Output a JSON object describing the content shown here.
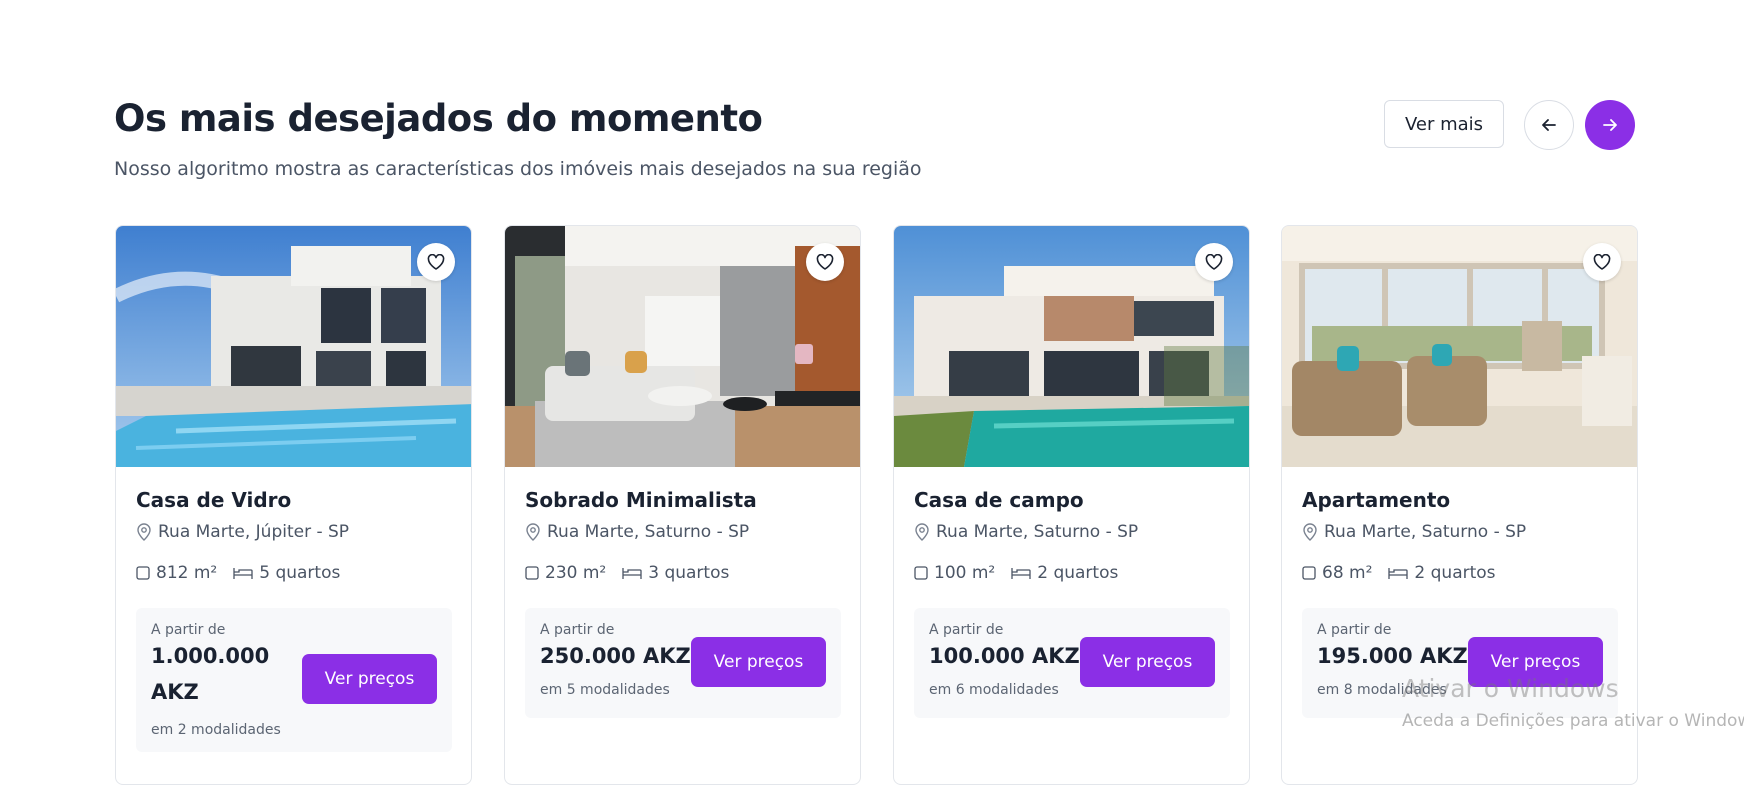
{
  "section": {
    "title": "Os mais desejados do momento",
    "subtitle": "Nosso algoritmo mostra as características dos imóveis mais desejados na sua região",
    "more_label": "Ver mais",
    "prev_icon": "arrow-left-icon",
    "next_icon": "arrow-right-icon"
  },
  "colors": {
    "accent": "#8b2fe6",
    "text_dark": "#1a2231",
    "text_muted": "#4b5565",
    "price_box_bg": "#f7f8fa"
  },
  "cards": [
    {
      "name": "Casa de Vidro",
      "address": "Rua Marte, Júpiter - SP",
      "area": "812 m²",
      "rooms": "5 quartos",
      "from_label": "A partir de",
      "price": "1.000.000 AKZ",
      "modes": "em 2 modalidades",
      "button": "Ver preços"
    },
    {
      "name": "Sobrado Minimalista",
      "address": "Rua Marte, Saturno - SP",
      "area": "230 m²",
      "rooms": "3 quartos",
      "from_label": "A partir de",
      "price": "250.000 AKZ",
      "modes": "em 5 modalidades",
      "button": "Ver preços"
    },
    {
      "name": "Casa de campo",
      "address": "Rua Marte, Saturno - SP",
      "area": "100 m²",
      "rooms": "2 quartos",
      "from_label": "A partir de",
      "price": "100.000 AKZ",
      "modes": "em 6 modalidades",
      "button": "Ver preços"
    },
    {
      "name": "Apartamento",
      "address": "Rua Marte, Saturno - SP",
      "area": "68 m²",
      "rooms": "2 quartos",
      "from_label": "A partir de",
      "price": "195.000 AKZ",
      "modes": "em 8 modalidades",
      "button": "Ver preços"
    }
  ],
  "watermark": {
    "title": "Ativar o Windows",
    "text": "Aceda a Definições para ativar o Windows."
  }
}
